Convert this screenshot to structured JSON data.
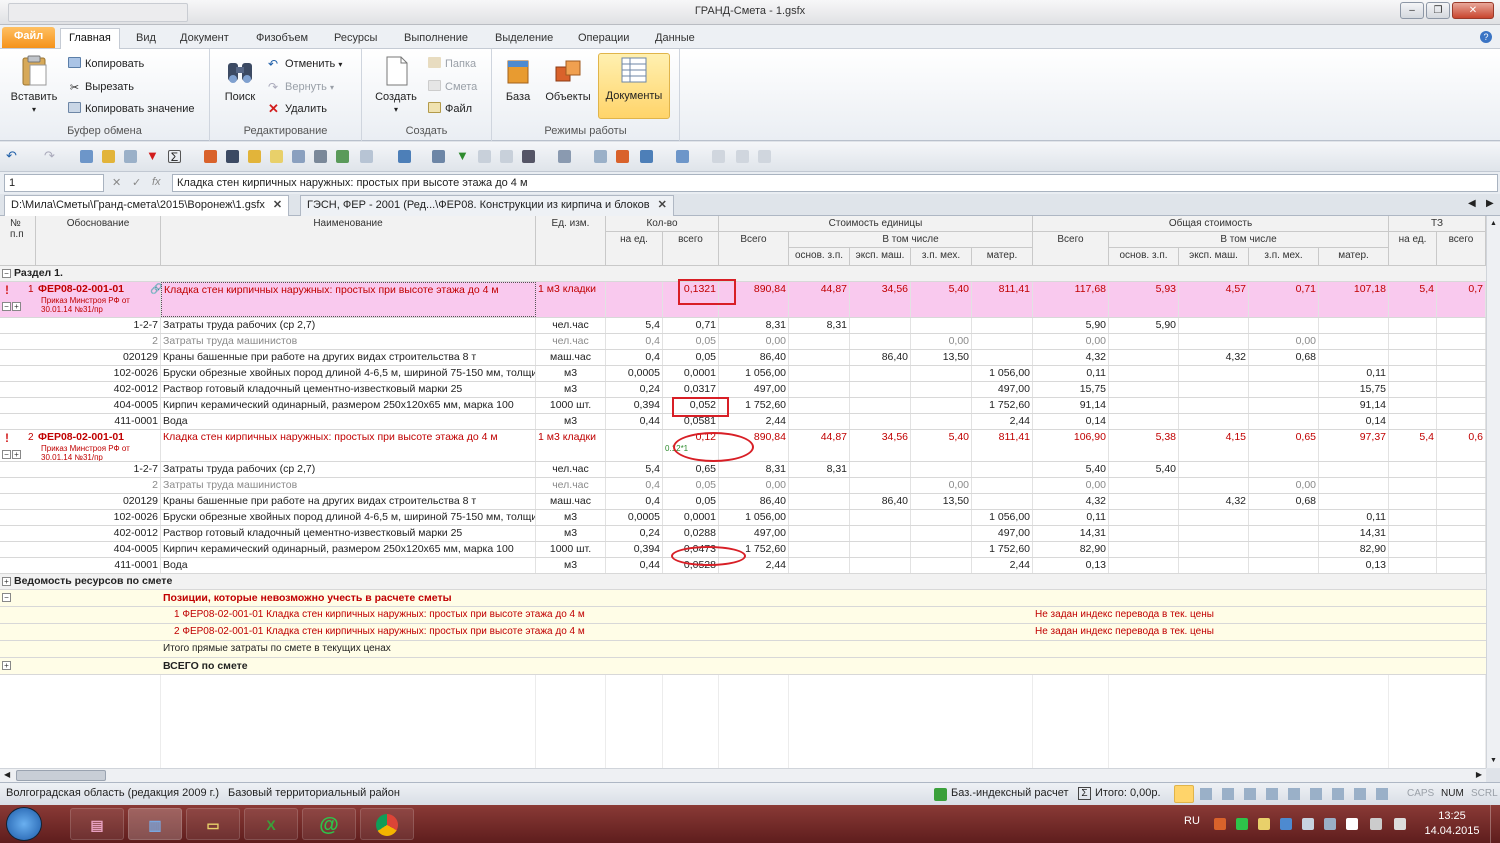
{
  "window": {
    "title": "ГРАНД-Смета - 1.gsfx"
  },
  "menu": {
    "file": "Файл",
    "tabs": [
      "Главная",
      "Вид",
      "Документ",
      "Физобъем",
      "Ресурсы",
      "Выполнение",
      "Выделение",
      "Операции",
      "Данные"
    ]
  },
  "ribbon": {
    "clipboard": {
      "paste": "Вставить",
      "copy": "Копировать",
      "cut": "Вырезать",
      "copy_value": "Копировать значение",
      "label": "Буфер обмена"
    },
    "editing": {
      "search": "Поиск",
      "undo": "Отменить",
      "redo": "Вернуть",
      "delete": "Удалить",
      "label": "Редактирование"
    },
    "create": {
      "create": "Создать",
      "folder": "Папка",
      "estimate": "Смета",
      "file": "Файл",
      "label": "Создать"
    },
    "modes": {
      "base": "База",
      "objects": "Объекты",
      "documents": "Документы",
      "label": "Режимы работы"
    }
  },
  "formula_bar": {
    "cell_ref": "1",
    "cancel": "✕",
    "confirm": "✓",
    "fx": "fx",
    "content": "Кладка стен кирпичных наружных: простых при высоте этажа до 4 м"
  },
  "doc_tabs": [
    {
      "label": "D:\\Мила\\Сметы\\Гранд-смета\\2015\\Воронеж\\1.gsfx",
      "close": "✕"
    },
    {
      "label": "ГЭСН, ФЕР - 2001 (Ред...\\ФЕР08. Конструкции из кирпича и блоков",
      "close": "✕"
    }
  ],
  "headers": {
    "num": "№ п.п",
    "basis": "Обоснование",
    "name": "Наименование",
    "unit": "Ед. изм.",
    "qty": "Кол-во",
    "qty_per": "на ед.",
    "qty_total": "всего",
    "unit_cost": "Стоимость единицы",
    "total_cost": "Общая стоимость",
    "total": "Всего",
    "incl": "В том числе",
    "osn": "основ. з.п.",
    "eksp": "эксп. маш.",
    "zpmeh": "з.п. мех.",
    "mater": "матер.",
    "tz": "ТЗ",
    "tz_per": "на ед.",
    "tz_total": "всего"
  },
  "section": {
    "label": "Раздел 1."
  },
  "positions": [
    {
      "num": "1",
      "code": "ФЕР08-02-001-01",
      "order": "Приказ Минстроя РФ от",
      "order_date": "30.01.14 №31/пр",
      "name": "Кладка стен кирпичных наружных: простых при высоте этажа до 4 м",
      "unit": "1 м3 кладки",
      "qty_total": "0,1321",
      "qty_formula": "",
      "uc_total": "890,84",
      "uc_osn": "44,87",
      "uc_eksp": "34,56",
      "uc_zpmeh": "5,40",
      "uc_mat": "811,41",
      "tc_total": "117,68",
      "tc_osn": "5,93",
      "tc_eksp": "4,57",
      "tc_zpmeh": "0,71",
      "tc_mat": "107,18",
      "tz_per": "5,4",
      "tz_total": "0,7",
      "resources": [
        {
          "code": "1-2-7",
          "name": "Затраты труда рабочих (ср 2,7)",
          "unit": "чел.час",
          "per": "5,4",
          "total": "0,71",
          "price": "8,31",
          "osn": "8,31",
          "eksp": "",
          "zpmeh": "",
          "mat": "",
          "tc_total": "5,90",
          "tc_osn": "5,90",
          "tc_eksp": "",
          "tc_zpmeh": "",
          "tc_mat": "",
          "gray": false
        },
        {
          "code": "2",
          "name": "Затраты труда машинистов",
          "unit": "чел.час",
          "per": "0,4",
          "total": "0,05",
          "price": "0,00",
          "osn": "",
          "eksp": "",
          "zpmeh": "0,00",
          "mat": "",
          "tc_total": "0,00",
          "tc_osn": "",
          "tc_eksp": "",
          "tc_zpmeh": "0,00",
          "tc_mat": "",
          "gray": true
        },
        {
          "code": "020129",
          "name": "Краны башенные при работе на других видах строительства 8 т",
          "unit": "маш.час",
          "per": "0,4",
          "total": "0,05",
          "price": "86,40",
          "osn": "",
          "eksp": "86,40",
          "zpmeh": "13,50",
          "mat": "",
          "tc_total": "4,32",
          "tc_osn": "",
          "tc_eksp": "4,32",
          "tc_zpmeh": "0,68",
          "tc_mat": "",
          "gray": false
        },
        {
          "code": "102-0026",
          "name": "Бруски обрезные хвойных пород длиной 4-6,5 м, шириной 75-150 мм, толщин",
          "unit": "м3",
          "per": "0,0005",
          "total": "0,0001",
          "price": "1 056,00",
          "osn": "",
          "eksp": "",
          "zpmeh": "",
          "mat": "1 056,00",
          "tc_total": "0,11",
          "tc_osn": "",
          "tc_eksp": "",
          "tc_zpmeh": "",
          "tc_mat": "0,11",
          "gray": false
        },
        {
          "code": "402-0012",
          "name": "Раствор готовый кладочный цементно-известковый марки 25",
          "unit": "м3",
          "per": "0,24",
          "total": "0,0317",
          "price": "497,00",
          "osn": "",
          "eksp": "",
          "zpmeh": "",
          "mat": "497,00",
          "tc_total": "15,75",
          "tc_osn": "",
          "tc_eksp": "",
          "tc_zpmeh": "",
          "tc_mat": "15,75",
          "gray": false
        },
        {
          "code": "404-0005",
          "name": "Кирпич керамический одинарный, размером 250х120х65 мм, марка 100",
          "unit": "1000 шт.",
          "per": "0,394",
          "total": "0,052",
          "price": "1 752,60",
          "osn": "",
          "eksp": "",
          "zpmeh": "",
          "mat": "1 752,60",
          "tc_total": "91,14",
          "tc_osn": "",
          "tc_eksp": "",
          "tc_zpmeh": "",
          "tc_mat": "91,14",
          "gray": false
        },
        {
          "code": "411-0001",
          "name": "Вода",
          "unit": "м3",
          "per": "0,44",
          "total": "0,0581",
          "price": "2,44",
          "osn": "",
          "eksp": "",
          "zpmeh": "",
          "mat": "2,44",
          "tc_total": "0,14",
          "tc_osn": "",
          "tc_eksp": "",
          "tc_zpmeh": "",
          "tc_mat": "0,14",
          "gray": false
        }
      ]
    },
    {
      "num": "2",
      "code": "ФЕР08-02-001-01",
      "order": "Приказ Минстроя РФ от",
      "order_date": "30.01.14 №31/пр",
      "name": "Кладка стен кирпичных наружных: простых при высоте этажа до 4 м",
      "unit": "1 м3 кладки",
      "qty_total": "0,12",
      "qty_formula": "0.12*1",
      "uc_total": "890,84",
      "uc_osn": "44,87",
      "uc_eksp": "34,56",
      "uc_zpmeh": "5,40",
      "uc_mat": "811,41",
      "tc_total": "106,90",
      "tc_osn": "5,38",
      "tc_eksp": "4,15",
      "tc_zpmeh": "0,65",
      "tc_mat": "97,37",
      "tz_per": "5,4",
      "tz_total": "0,6",
      "resources": [
        {
          "code": "1-2-7",
          "name": "Затраты труда рабочих (ср 2,7)",
          "unit": "чел.час",
          "per": "5,4",
          "total": "0,65",
          "price": "8,31",
          "osn": "8,31",
          "eksp": "",
          "zpmeh": "",
          "mat": "",
          "tc_total": "5,40",
          "tc_osn": "5,40",
          "tc_eksp": "",
          "tc_zpmeh": "",
          "tc_mat": "",
          "gray": false
        },
        {
          "code": "2",
          "name": "Затраты труда машинистов",
          "unit": "чел.час",
          "per": "0,4",
          "total": "0,05",
          "price": "0,00",
          "osn": "",
          "eksp": "",
          "zpmeh": "0,00",
          "mat": "",
          "tc_total": "0,00",
          "tc_osn": "",
          "tc_eksp": "",
          "tc_zpmeh": "0,00",
          "tc_mat": "",
          "gray": true
        },
        {
          "code": "020129",
          "name": "Краны башенные при работе на других видах строительства 8 т",
          "unit": "маш.час",
          "per": "0,4",
          "total": "0,05",
          "price": "86,40",
          "osn": "",
          "eksp": "86,40",
          "zpmeh": "13,50",
          "mat": "",
          "tc_total": "4,32",
          "tc_osn": "",
          "tc_eksp": "4,32",
          "tc_zpmeh": "0,68",
          "tc_mat": "",
          "gray": false
        },
        {
          "code": "102-0026",
          "name": "Бруски обрезные хвойных пород длиной 4-6,5 м, шириной 75-150 мм, толщин",
          "unit": "м3",
          "per": "0,0005",
          "total": "0,0001",
          "price": "1 056,00",
          "osn": "",
          "eksp": "",
          "zpmeh": "",
          "mat": "1 056,00",
          "tc_total": "0,11",
          "tc_osn": "",
          "tc_eksp": "",
          "tc_zpmeh": "",
          "tc_mat": "0,11",
          "gray": false
        },
        {
          "code": "402-0012",
          "name": "Раствор готовый кладочный цементно-известковый марки 25",
          "unit": "м3",
          "per": "0,24",
          "total": "0,0288",
          "price": "497,00",
          "osn": "",
          "eksp": "",
          "zpmeh": "",
          "mat": "497,00",
          "tc_total": "14,31",
          "tc_osn": "",
          "tc_eksp": "",
          "tc_zpmeh": "",
          "tc_mat": "14,31",
          "gray": false
        },
        {
          "code": "404-0005",
          "name": "Кирпич керамический одинарный, размером 250х120х65 мм, марка 100",
          "unit": "1000 шт.",
          "per": "0,394",
          "total": "0,0473",
          "price": "1 752,60",
          "osn": "",
          "eksp": "",
          "zpmeh": "",
          "mat": "1 752,60",
          "tc_total": "82,90",
          "tc_osn": "",
          "tc_eksp": "",
          "tc_zpmeh": "",
          "tc_mat": "82,90",
          "gray": false
        },
        {
          "code": "411-0001",
          "name": "Вода",
          "unit": "м3",
          "per": "0,44",
          "total": "0,0528",
          "price": "2,44",
          "osn": "",
          "eksp": "",
          "zpmeh": "",
          "mat": "2,44",
          "tc_total": "0,13",
          "tc_osn": "",
          "tc_eksp": "",
          "tc_zpmeh": "",
          "tc_mat": "0,13",
          "gray": false
        }
      ]
    }
  ],
  "footer": {
    "resources_sheet": "Ведомость ресурсов по смете",
    "impossible": "Позиции, которые невозможно учесть в расчете сметы",
    "impossible_items": [
      {
        "text": "1 ФЕР08-02-001-01 Кладка стен кирпичных наружных: простых при высоте этажа до 4 м",
        "reason": "Не задан индекс перевода в тек. цены"
      },
      {
        "text": "2 ФЕР08-02-001-01 Кладка стен кирпичных наружных: простых при высоте этажа до 4 м",
        "reason": "Не задан индекс перевода в тек. цены"
      }
    ],
    "direct_costs": "Итого прямые затраты по смете в текущих ценах",
    "grand_total": "ВСЕГО по смете"
  },
  "status": {
    "region": "Волгоградская область (редакция 2009 г.)",
    "district": "Базовый территориальный район",
    "calc_mode": "Баз.-индексный расчет",
    "total": "Итого: 0,00р.",
    "caps": "CAPS",
    "num": "NUM",
    "scrl": "SCRL"
  },
  "taskbar": {
    "lang": "RU",
    "time": "13:25",
    "date": "14.04.2015"
  },
  "colors": {
    "pink_row": "#f9c9ee",
    "annotation_red": "#d81f26",
    "accent_orange": "#f5921a",
    "taskbar": "#6e2a28"
  },
  "icons": [
    "windows-start-icon",
    "winrar-icon",
    "grand-smeta-icon",
    "explorer-icon",
    "excel-icon",
    "mail-icon",
    "chrome-icon"
  ]
}
